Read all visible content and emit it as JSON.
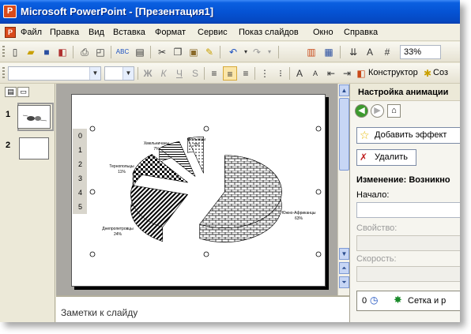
{
  "window": {
    "title": "Microsoft PowerPoint - [Презентация1]",
    "app_icon": "P"
  },
  "menu": {
    "items": [
      "Файл",
      "Правка",
      "Вид",
      "Вставка",
      "Формат",
      "Сервис",
      "Показ слайдов",
      "Окно",
      "Справка"
    ]
  },
  "toolbar": {
    "zoom": "33%",
    "constructor_label": "Конструктор",
    "create_label": "Соз"
  },
  "thumbnails": {
    "slides": [
      {
        "number": "1"
      },
      {
        "number": "2"
      }
    ]
  },
  "slide": {
    "table_rows": [
      "0",
      "1",
      "2",
      "3",
      "4",
      "5"
    ]
  },
  "chart_data": {
    "type": "pie",
    "style": "3d-exploded-pattern-fill",
    "slices": [
      {
        "label": "Южно-Африканцы",
        "value": 63,
        "display": "63%"
      },
      {
        "label": "Днепропетровцы",
        "value": 24,
        "display": "24%"
      },
      {
        "label": "Тернопольцы",
        "value": 11,
        "display": "11%"
      },
      {
        "label": "Хмельничаны",
        "value": 7,
        "display": "7%"
      },
      {
        "label": "Волынцы",
        "value": 5,
        "display": "5%"
      }
    ]
  },
  "notes": {
    "placeholder": "Заметки к слайду"
  },
  "taskpane": {
    "title": "Настройка анимации",
    "add_effect_label": "Добавить эффект",
    "remove_label": "Удалить",
    "change_label": "Изменение: Возникно",
    "start_label": "Начало:",
    "property_label": "Свойство:",
    "speed_label": "Скорость:",
    "list_item_number": "0",
    "list_item_label": "Сетка и р"
  },
  "colors": {
    "titlebar": "#0553d4",
    "chrome": "#ece9d8",
    "slide_area": "#a9a7a2"
  }
}
